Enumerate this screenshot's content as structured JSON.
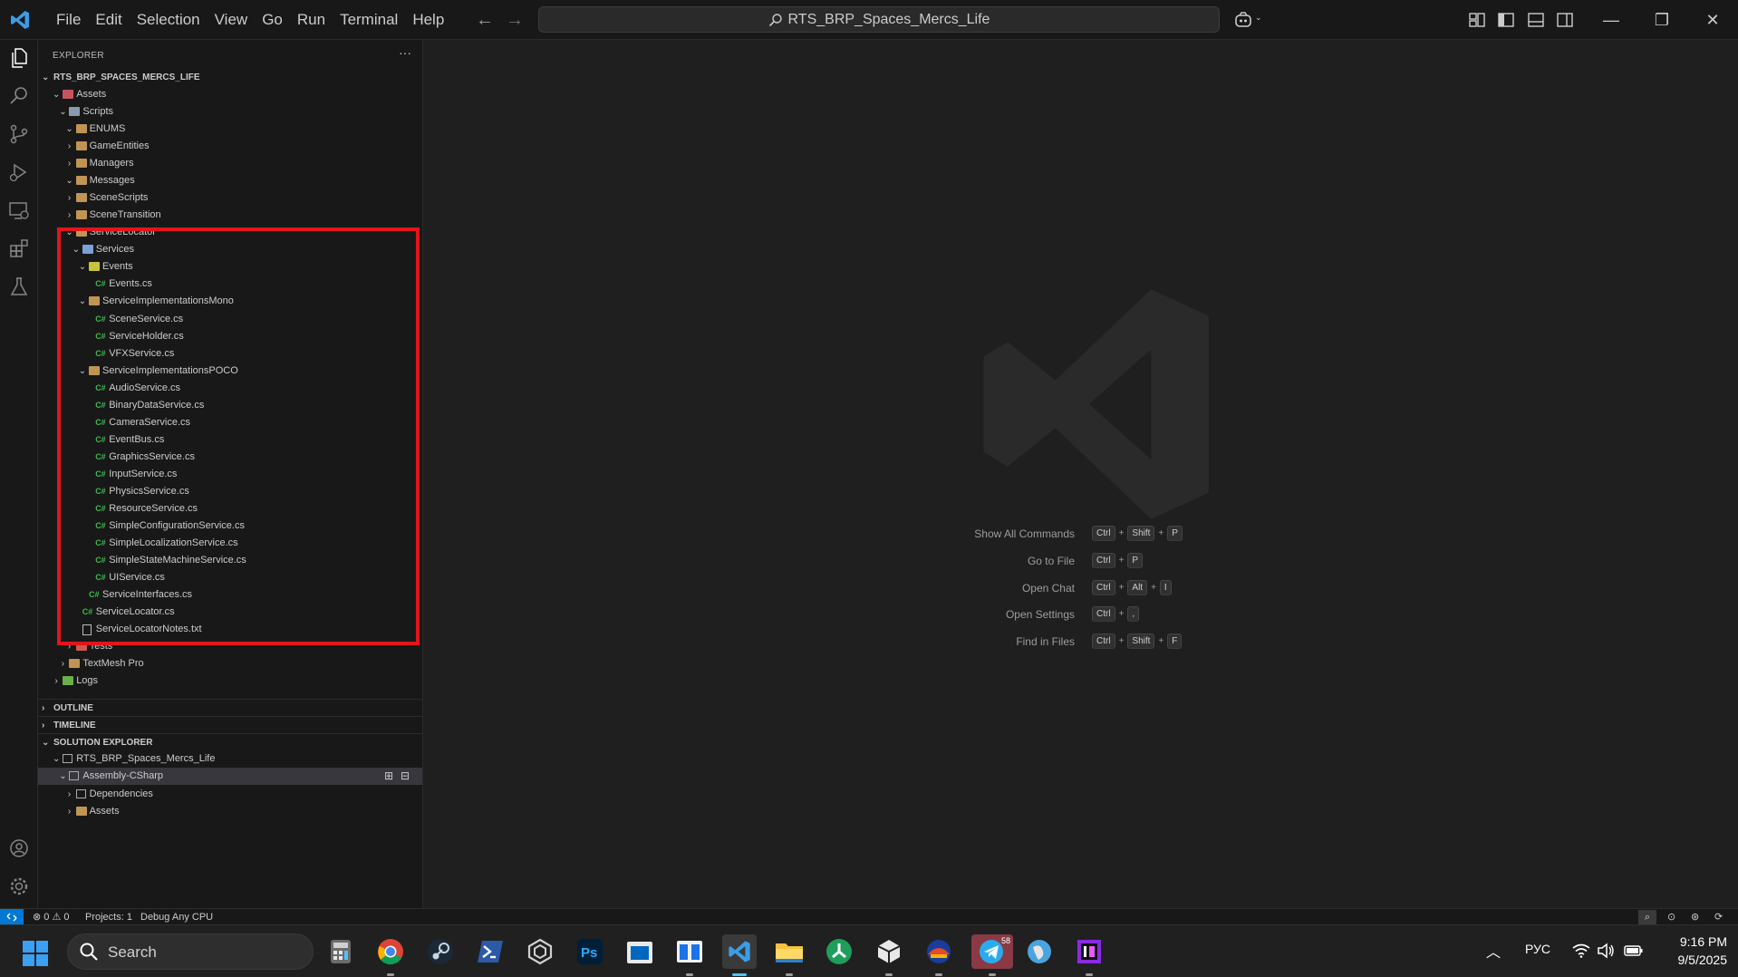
{
  "titlebar": {
    "menu": [
      "File",
      "Edit",
      "Selection",
      "View",
      "Go",
      "Run",
      "Terminal",
      "Help"
    ],
    "command_center": "RTS_BRP_Spaces_Mercs_Life"
  },
  "sidebar": {
    "title": "EXPLORER",
    "more": "···",
    "root": "RTS_BRP_SPACES_MERCS_LIFE",
    "tree": [
      {
        "label": "Assets",
        "depth": 1,
        "expanded": true,
        "kind": "folder-unity"
      },
      {
        "label": "Scripts",
        "depth": 2,
        "expanded": true,
        "kind": "folder-script"
      },
      {
        "label": "ENUMS",
        "depth": 3,
        "expanded": true,
        "kind": "folder"
      },
      {
        "label": "GameEntities",
        "depth": 3,
        "expanded": false,
        "kind": "folder"
      },
      {
        "label": "Managers",
        "depth": 3,
        "expanded": false,
        "kind": "folder"
      },
      {
        "label": "Messages",
        "depth": 3,
        "expanded": true,
        "kind": "folder"
      },
      {
        "label": "SceneScripts",
        "depth": 3,
        "expanded": false,
        "kind": "folder"
      },
      {
        "label": "SceneTransition",
        "depth": 3,
        "expanded": false,
        "kind": "folder"
      },
      {
        "label": "ServiceLocator",
        "depth": 3,
        "expanded": true,
        "kind": "folder"
      },
      {
        "label": "Services",
        "depth": 4,
        "expanded": true,
        "kind": "folder-service"
      },
      {
        "label": "Events",
        "depth": 5,
        "expanded": true,
        "kind": "folder-event"
      },
      {
        "label": "Events.cs",
        "depth": 6,
        "kind": "cs"
      },
      {
        "label": "ServiceImplementationsMono",
        "depth": 5,
        "expanded": true,
        "kind": "folder"
      },
      {
        "label": "SceneService.cs",
        "depth": 6,
        "kind": "cs"
      },
      {
        "label": "ServiceHolder.cs",
        "depth": 6,
        "kind": "cs"
      },
      {
        "label": "VFXService.cs",
        "depth": 6,
        "kind": "cs"
      },
      {
        "label": "ServiceImplementationsPOCO",
        "depth": 5,
        "expanded": true,
        "kind": "folder"
      },
      {
        "label": "AudioService.cs",
        "depth": 6,
        "kind": "cs"
      },
      {
        "label": "BinaryDataService.cs",
        "depth": 6,
        "kind": "cs"
      },
      {
        "label": "CameraService.cs",
        "depth": 6,
        "kind": "cs"
      },
      {
        "label": "EventBus.cs",
        "depth": 6,
        "kind": "cs"
      },
      {
        "label": "GraphicsService.cs",
        "depth": 6,
        "kind": "cs"
      },
      {
        "label": "InputService.cs",
        "depth": 6,
        "kind": "cs"
      },
      {
        "label": "PhysicsService.cs",
        "depth": 6,
        "kind": "cs"
      },
      {
        "label": "ResourceService.cs",
        "depth": 6,
        "kind": "cs"
      },
      {
        "label": "SimpleConfigurationService.cs",
        "depth": 6,
        "kind": "cs"
      },
      {
        "label": "SimpleLocalizationService.cs",
        "depth": 6,
        "kind": "cs"
      },
      {
        "label": "SimpleStateMachineService.cs",
        "depth": 6,
        "kind": "cs"
      },
      {
        "label": "UIService.cs",
        "depth": 6,
        "kind": "cs"
      },
      {
        "label": "ServiceInterfaces.cs",
        "depth": 5,
        "kind": "cs"
      },
      {
        "label": "ServiceLocator.cs",
        "depth": 4,
        "kind": "cs"
      },
      {
        "label": "ServiceLocatorNotes.txt",
        "depth": 4,
        "kind": "txt"
      },
      {
        "label": "Tests",
        "depth": 3,
        "expanded": false,
        "kind": "folder-test"
      },
      {
        "label": "TextMesh Pro",
        "depth": 2,
        "expanded": false,
        "kind": "folder"
      },
      {
        "label": "Logs",
        "depth": 1,
        "expanded": false,
        "kind": "folder-log"
      }
    ],
    "sections": {
      "outline": "OUTLINE",
      "timeline": "TIMELINE",
      "solution_explorer": "SOLUTION EXPLORER"
    },
    "solution_tree": [
      {
        "label": "RTS_BRP_Spaces_Mercs_Life",
        "depth": 1,
        "expanded": true,
        "kind": "solution"
      },
      {
        "label": "Assembly-CSharp",
        "depth": 2,
        "expanded": true,
        "kind": "project",
        "selected": true
      },
      {
        "label": "Dependencies",
        "depth": 3,
        "expanded": false,
        "kind": "deps"
      },
      {
        "label": "Assets",
        "depth": 3,
        "expanded": false,
        "kind": "folder"
      }
    ]
  },
  "editor": {
    "shortcuts": [
      {
        "label": "Show All Commands",
        "keys": [
          "Ctrl",
          "Shift",
          "P"
        ]
      },
      {
        "label": "Go to File",
        "keys": [
          "Ctrl",
          "P"
        ]
      },
      {
        "label": "Open Chat",
        "keys": [
          "Ctrl",
          "Alt",
          "I"
        ]
      },
      {
        "label": "Open Settings",
        "keys": [
          "Ctrl",
          ","
        ]
      },
      {
        "label": "Find in Files",
        "keys": [
          "Ctrl",
          "Shift",
          "F"
        ]
      }
    ]
  },
  "statusbar": {
    "errors": "0",
    "warnings": "0",
    "projects": "Projects: 1",
    "config": "Debug Any CPU"
  },
  "taskbar": {
    "search_placeholder": "Search",
    "language": "РУС",
    "time": "9:16 PM",
    "date": "9/5/2025",
    "telegram_badge": "58"
  },
  "colors": {
    "accent": "#0078d4",
    "highlight_box": "#e3141c",
    "cs_icon": "#3fb950",
    "folder": "#c09553"
  }
}
